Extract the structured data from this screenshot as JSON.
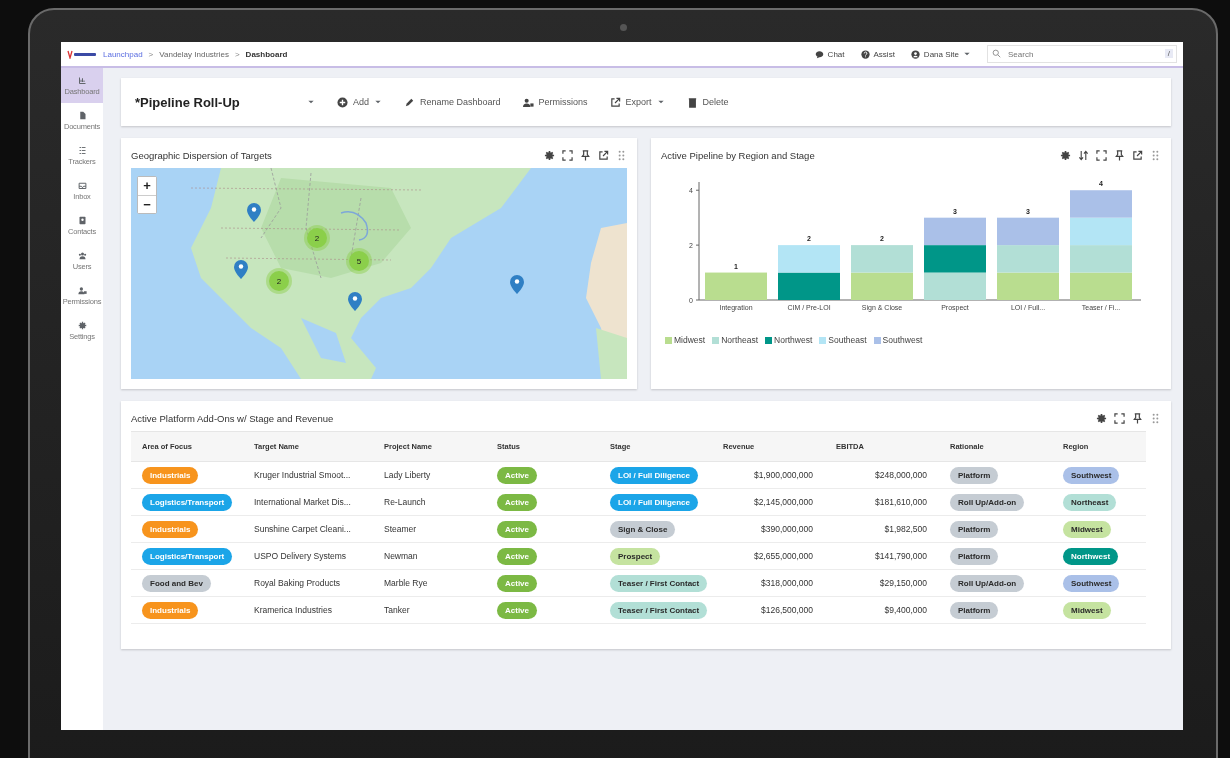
{
  "breadcrumb": [
    {
      "label": "Launchpad",
      "kind": "link"
    },
    {
      "separator": ">",
      "label": "Vandelay Industries",
      "kind": "crumb"
    },
    {
      "separator": ">",
      "label": "Dashboard",
      "kind": "current"
    }
  ],
  "topbar": {
    "chat": "Chat",
    "assist": "Assist",
    "user": "Dana Site",
    "search": {
      "placeholder": "Search",
      "shortcut": "/"
    }
  },
  "sidebar": {
    "items": [
      {
        "label": "Dashboard",
        "selected": true
      },
      {
        "label": "Documents",
        "selected": false
      },
      {
        "label": "Trackers",
        "selected": false
      },
      {
        "label": "Inbox",
        "selected": false
      },
      {
        "label": "Contacts",
        "selected": false
      },
      {
        "label": "Users",
        "selected": false
      },
      {
        "label": "Permissions",
        "selected": false
      },
      {
        "label": "Settings",
        "selected": false
      }
    ]
  },
  "toolbar": {
    "title": "*Pipeline Roll-Up",
    "actions": [
      "Add",
      "Rename Dashboard",
      "Permissions",
      "Export",
      "Delete"
    ]
  },
  "map_widget": {
    "title": "Geographic Dispersion of Targets",
    "zoom_in": "+",
    "zoom_out": "−",
    "clusters": [
      "2",
      "2",
      "5"
    ]
  },
  "chart_widget": {
    "title": "Active Pipeline by Region and Stage",
    "chart_data": {
      "type": "bar",
      "stacked": true,
      "categories": [
        "Integration",
        "CIM / Pre-LOI",
        "Sign & Close",
        "Prospect",
        "LOI / Full...",
        "Teaser / Fi..."
      ],
      "ylim": [
        0,
        4.3
      ],
      "yticks": [
        0,
        2,
        4
      ],
      "value_labels": [
        "1",
        "2",
        "2",
        "3",
        "3",
        "4"
      ],
      "series": [
        {
          "name": "Midwest",
          "color": "#b9dd8f",
          "values": [
            1,
            0,
            1,
            0,
            1,
            1
          ]
        },
        {
          "name": "Northeast",
          "color": "#b2dfd6",
          "values": [
            0,
            0,
            1,
            1,
            1,
            1
          ]
        },
        {
          "name": "Northwest",
          "color": "#009688",
          "values": [
            0,
            1,
            0,
            1,
            0,
            0
          ]
        },
        {
          "name": "Southeast",
          "color": "#b3e5f5",
          "values": [
            0,
            1,
            0,
            0,
            0,
            1
          ]
        },
        {
          "name": "Southwest",
          "color": "#aac0e8",
          "values": [
            0,
            0,
            0,
            1,
            1,
            1
          ]
        }
      ]
    }
  },
  "table_widget": {
    "title": "Active Platform Add-Ons w/ Stage and Revenue",
    "columns": [
      {
        "label": "Area of Focus",
        "kind": "pill"
      },
      {
        "label": "Target Name",
        "kind": "text"
      },
      {
        "label": "Project Name",
        "kind": "text"
      },
      {
        "label": "Status",
        "kind": "pill"
      },
      {
        "label": "Stage",
        "kind": "pill"
      },
      {
        "label": "Revenue",
        "kind": "number"
      },
      {
        "label": "EBITDA",
        "kind": "number"
      },
      {
        "label": "Rationale",
        "kind": "pill"
      },
      {
        "label": "Region",
        "kind": "pill"
      }
    ],
    "rows": [
      {
        "cells": [
          {
            "text": "Industrials",
            "color": "#f7941d"
          },
          "Kruger Industrial Smoot...",
          "Lady Liberty",
          {
            "text": "Active",
            "color": "#7cb944"
          },
          {
            "text": "LOI / Full Diligence",
            "color": "#1ba5e8"
          },
          "$1,900,000,000",
          "$248,000,000",
          {
            "text": "Platform",
            "color": "#c5ccd3"
          },
          {
            "text": "Southwest",
            "color": "#aac0e8"
          }
        ]
      },
      {
        "cells": [
          {
            "text": "Logistics/Transport",
            "color": "#1ba5e8"
          },
          "International Market Dis...",
          "Re-Launch",
          {
            "text": "Active",
            "color": "#7cb944"
          },
          {
            "text": "LOI / Full Diligence",
            "color": "#1ba5e8"
          },
          "$2,145,000,000",
          "$181,610,000",
          {
            "text": "Roll Up/Add-on",
            "color": "#c5ccd3"
          },
          {
            "text": "Northeast",
            "color": "#b2dfd6"
          }
        ]
      },
      {
        "cells": [
          {
            "text": "Industrials",
            "color": "#f7941d"
          },
          "Sunshine Carpet Cleani...",
          "Steamer",
          {
            "text": "Active",
            "color": "#7cb944"
          },
          {
            "text": "Sign & Close",
            "color": "#c5ccd3"
          },
          "$390,000,000",
          "$1,982,500",
          {
            "text": "Platform",
            "color": "#c5ccd3"
          },
          {
            "text": "Midwest",
            "color": "#c5e3a0"
          }
        ]
      },
      {
        "cells": [
          {
            "text": "Logistics/Transport",
            "color": "#1ba5e8"
          },
          "USPO Delivery Systems",
          "Newman",
          {
            "text": "Active",
            "color": "#7cb944"
          },
          {
            "text": "Prospect",
            "color": "#c5e3a0"
          },
          "$2,655,000,000",
          "$141,790,000",
          {
            "text": "Platform",
            "color": "#c5ccd3"
          },
          {
            "text": "Northwest",
            "color": "#009688"
          }
        ]
      },
      {
        "cells": [
          {
            "text": "Food and Bev",
            "color": "#c5ccd3"
          },
          "Royal Baking Products",
          "Marble Rye",
          {
            "text": "Active",
            "color": "#7cb944"
          },
          {
            "text": "Teaser / First Contact",
            "color": "#b2dfd6"
          },
          "$318,000,000",
          "$29,150,000",
          {
            "text": "Roll Up/Add-on",
            "color": "#c5ccd3"
          },
          {
            "text": "Southwest",
            "color": "#aac0e8"
          }
        ]
      },
      {
        "cells": [
          {
            "text": "Industrials",
            "color": "#f7941d"
          },
          "Kramerica Industries",
          "Tanker",
          {
            "text": "Active",
            "color": "#7cb944"
          },
          {
            "text": "Teaser / First Contact",
            "color": "#b2dfd6"
          },
          "$126,500,000",
          "$9,400,000",
          {
            "text": "Platform",
            "color": "#c5ccd3"
          },
          {
            "text": "Midwest",
            "color": "#c5e3a0"
          }
        ]
      }
    ]
  }
}
